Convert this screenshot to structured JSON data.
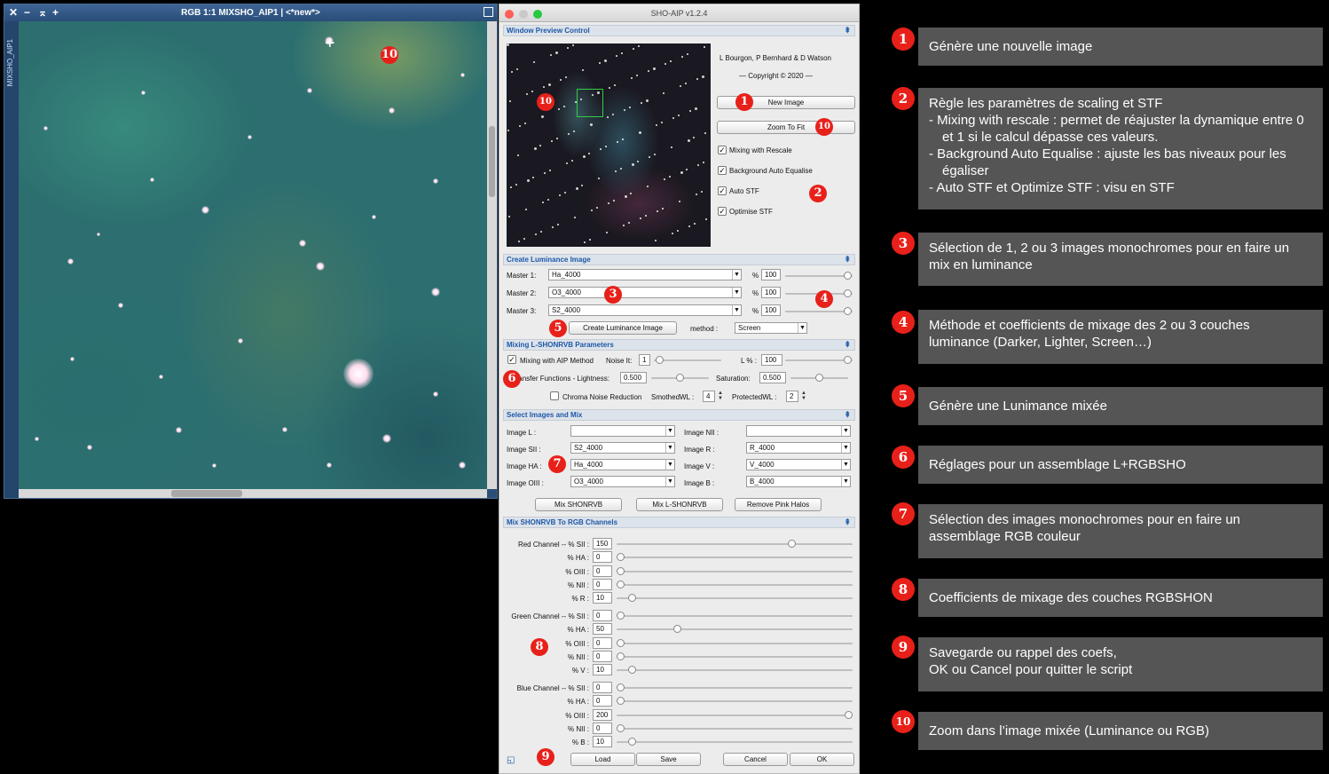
{
  "image_window": {
    "title": "RGB 1:1 MIXSHO_AIP1 | <*new*>",
    "side_tab": "MIXSHO_AIP1",
    "controls": [
      "✕",
      "−",
      "⌅",
      "+"
    ]
  },
  "dialog": {
    "title": "SHO-AIP v1.2.4",
    "window_preview": {
      "header": "Window Preview Control",
      "authors": "L Bourgon, P Bernhard & D Watson",
      "copyright": "— Copyright © 2020 —",
      "new_image": "New Image",
      "zoom_to_fit": "Zoom To Fit",
      "checks": [
        {
          "label": "Mixing with Rescale",
          "checked": true
        },
        {
          "label": "Background Auto Equalise",
          "checked": true
        },
        {
          "label": "Auto STF",
          "checked": true
        },
        {
          "label": "Optimise STF",
          "checked": true
        }
      ]
    },
    "luminance": {
      "header": "Create Luminance Image",
      "masters": [
        {
          "label": "Master 1:",
          "value": "Ha_4000",
          "pct_label": "%",
          "pct": "100"
        },
        {
          "label": "Master 2:",
          "value": "O3_4000",
          "pct_label": "%",
          "pct": "100"
        },
        {
          "label": "Master 3:",
          "value": "S2_4000",
          "pct_label": "%",
          "pct": "100"
        }
      ],
      "create_button": "Create Luminance Image",
      "method_label": "method :",
      "method_value": "Screen"
    },
    "mixing": {
      "header": "Mixing L-SHONRVB Parameters",
      "aip_label": "Mixing with AIP Method",
      "noise_label": "Noise It:",
      "noise_value": "1",
      "l_label": "L % :",
      "l_value": "100",
      "transfer_label": "Transfer Functions - Lightness:",
      "transfer_value": "0.500",
      "saturation_label": "Saturation:",
      "saturation_value": "0.500",
      "chroma_label": "Chroma Noise Reduction",
      "smoothed_label": "SmothedWL :",
      "smoothed_value": "4",
      "protected_label": "ProtectedWL :",
      "protected_value": "2"
    },
    "select": {
      "header": "Select Images and Mix",
      "left": [
        {
          "label": "Image L :",
          "value": ""
        },
        {
          "label": "Image SII :",
          "value": "S2_4000"
        },
        {
          "label": "Image HA :",
          "value": "Ha_4000"
        },
        {
          "label": "Image OIII :",
          "value": "O3_4000"
        }
      ],
      "right": [
        {
          "label": "Image NII :",
          "value": ""
        },
        {
          "label": "Image R :",
          "value": "R_4000"
        },
        {
          "label": "Image V :",
          "value": "V_4000"
        },
        {
          "label": "Image B :",
          "value": "B_4000"
        }
      ],
      "buttons": [
        "Mix SHONRVB",
        "Mix L-SHONRVB",
        "Remove Pink Halos"
      ]
    },
    "channels": {
      "header": "Mix SHONRVB To RGB Channels",
      "rows": [
        {
          "label": "Red Channel -- % SII :",
          "value": "150",
          "level": 0.75
        },
        {
          "label": "% HA :",
          "value": "0",
          "level": 0.0
        },
        {
          "label": "% OIII :",
          "value": "0",
          "level": 0.0
        },
        {
          "label": "% NII :",
          "value": "0",
          "level": 0.0
        },
        {
          "label": "% R :",
          "value": "10",
          "level": 0.05
        },
        {
          "label": "Green Channel -- % SII :",
          "value": "0",
          "level": 0.0
        },
        {
          "label": "% HA :",
          "value": "50",
          "level": 0.25
        },
        {
          "label": "% OIII :",
          "value": "0",
          "level": 0.0
        },
        {
          "label": "% NII :",
          "value": "0",
          "level": 0.0
        },
        {
          "label": "% V :",
          "value": "10",
          "level": 0.05
        },
        {
          "label": "Blue Channel -- % SII :",
          "value": "0",
          "level": 0.0
        },
        {
          "label": "% HA :",
          "value": "0",
          "level": 0.0
        },
        {
          "label": "% OIII :",
          "value": "200",
          "level": 1.0
        },
        {
          "label": "% NII :",
          "value": "0",
          "level": 0.0
        },
        {
          "label": "% B :",
          "value": "10",
          "level": 0.05
        }
      ]
    },
    "bottom": {
      "load": "Load",
      "save": "Save",
      "cancel": "Cancel",
      "ok": "OK"
    }
  },
  "markers": {
    "m1": "1",
    "m2": "2",
    "m3": "3",
    "m4": "4",
    "m5": "5",
    "m6": "6",
    "m7": "7",
    "m8": "8",
    "m9": "9",
    "m10": "10"
  },
  "notes": {
    "n1": "Génère une nouvelle image",
    "n2_title": "Règle les paramètres de scaling et STF",
    "n2_items": [
      "- Mixing with rescale : permet de réajuster la dynamique entre 0 et 1 si le calcul dépasse ces valeurs.",
      "- Background Auto Equalise : ajuste les bas niveaux pour les égaliser",
      "- Auto STF et Optimize STF : visu en STF"
    ],
    "n3": "Sélection de 1, 2 ou 3 images monochromes pour en faire un mix en luminance",
    "n4": "Méthode et coefficients de mixage des 2 ou 3 couches luminance (Darker, Lighter, Screen…)",
    "n5": "Génère une Lunimance mixée",
    "n6": "Réglages pour un assemblage L+RGBSHO",
    "n7": "Sélection des images monochromes pour en faire un assemblage RGB couleur",
    "n8": "Coefficients de mixage des couches RGBSHON",
    "n9a": "Savegarde ou rappel des coefs,",
    "n9b": "OK ou Cancel pour quitter le script",
    "n10": "Zoom dans l’image mixée (Luminance ou RGB)"
  },
  "colors": {
    "marker": "#e8201a",
    "note_bg": "#555555",
    "section_text": "#1d58a8"
  }
}
